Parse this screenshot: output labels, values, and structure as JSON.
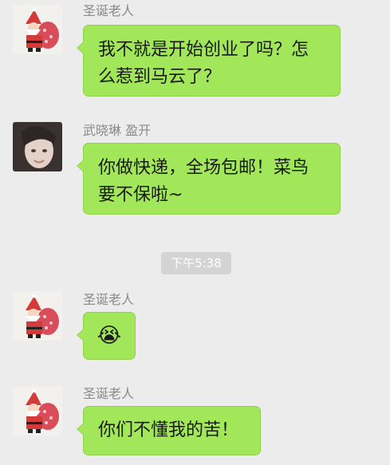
{
  "messages": [
    {
      "sender": "圣诞老人",
      "avatar": "santa-avatar",
      "lines": [
        "我不就是开始创业了吗？怎",
        "么惹到马云了？"
      ]
    },
    {
      "sender": "武晓琳 盈开",
      "avatar": "girl-photo-avatar",
      "lines": [
        "你做快递，全场包邮！菜鸟",
        "要不保啦~"
      ]
    },
    {
      "sender": "圣诞老人",
      "avatar": "santa-avatar",
      "emoji": "😭"
    },
    {
      "sender": "圣诞老人",
      "avatar": "santa-avatar",
      "lines": [
        "你们不懂我的苦！"
      ]
    }
  ],
  "timestamp": "下午5:38",
  "colors": {
    "bubble": "#a2e65a",
    "background": "#ececec",
    "timestamp_bg": "#d4d4d4"
  }
}
